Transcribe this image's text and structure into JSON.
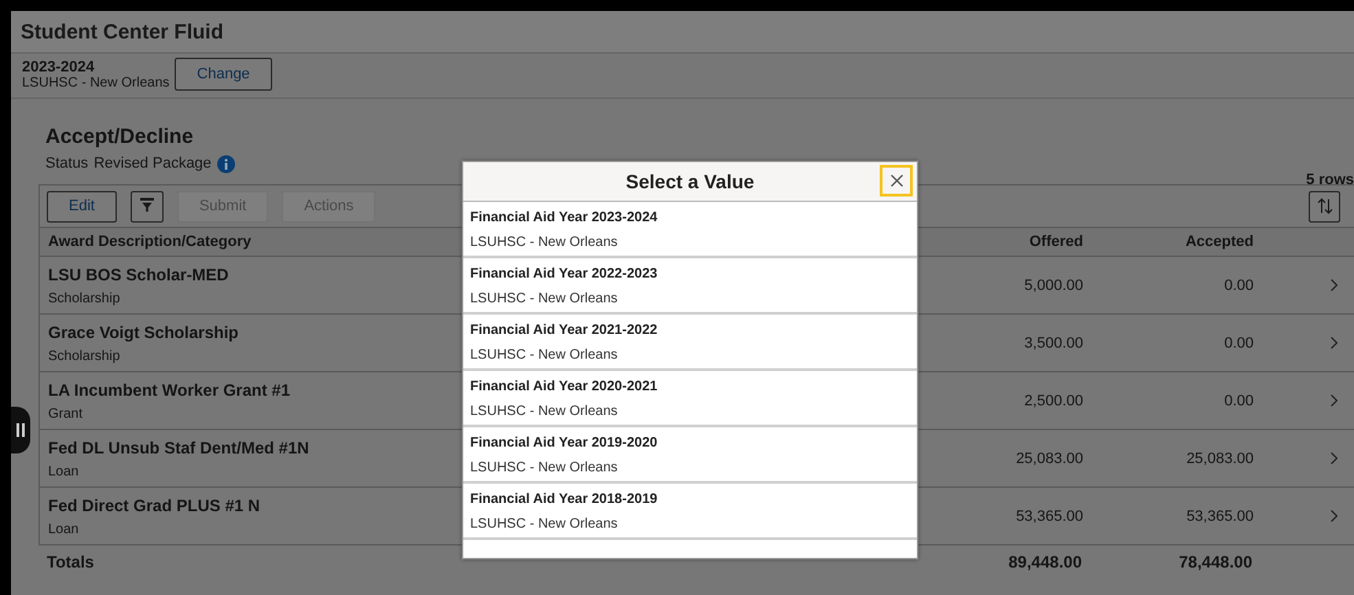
{
  "window": {
    "title": "Student Center Fluid"
  },
  "aid_year": {
    "year": "2023-2024",
    "institution": "LSUHSC - New Orleans",
    "button": "Change"
  },
  "section": {
    "title": "Accept/Decline",
    "status_label": "Status",
    "status_value": "Revised Package",
    "row_count": "5 rows"
  },
  "toolbar": [
    {
      "kind": "text",
      "label": "Edit",
      "disabled": false
    },
    {
      "kind": "filter",
      "disabled": false
    },
    {
      "kind": "text",
      "label": "Submit",
      "disabled": true
    },
    {
      "kind": "text",
      "label": "Actions",
      "disabled": true
    }
  ],
  "table": {
    "columns": [
      "Award Description/Category",
      "Offered",
      "Accepted"
    ],
    "rows": [
      {
        "name": "LSU BOS Scholar-MED",
        "category": "Scholarship",
        "offered": "5,000.00",
        "accepted": "0.00"
      },
      {
        "name": "Grace Voigt Scholarship",
        "category": "Scholarship",
        "offered": "3,500.00",
        "accepted": "0.00"
      },
      {
        "name": "LA Incumbent Worker Grant #1",
        "category": "Grant",
        "offered": "2,500.00",
        "accepted": "0.00"
      },
      {
        "name": "Fed DL Unsub Staf Dent/Med #1N",
        "category": "Loan",
        "offered": "25,083.00",
        "accepted": "25,083.00"
      },
      {
        "name": "Fed Direct Grad PLUS #1 N",
        "category": "Loan",
        "offered": "53,365.00",
        "accepted": "53,365.00"
      }
    ],
    "totals": {
      "label": "Totals",
      "offered": "89,448.00",
      "accepted": "78,448.00"
    }
  },
  "modal": {
    "title": "Select a Value",
    "options": [
      {
        "title": "Financial Aid Year 2023-2024",
        "subtitle": "LSUHSC - New Orleans"
      },
      {
        "title": "Financial Aid Year 2022-2023",
        "subtitle": "LSUHSC - New Orleans"
      },
      {
        "title": "Financial Aid Year 2021-2022",
        "subtitle": "LSUHSC - New Orleans"
      },
      {
        "title": "Financial Aid Year 2020-2021",
        "subtitle": "LSUHSC - New Orleans"
      },
      {
        "title": "Financial Aid Year 2019-2020",
        "subtitle": "LSUHSC - New Orleans"
      },
      {
        "title": "Financial Aid Year 2018-2019",
        "subtitle": "LSUHSC - New Orleans"
      }
    ]
  }
}
